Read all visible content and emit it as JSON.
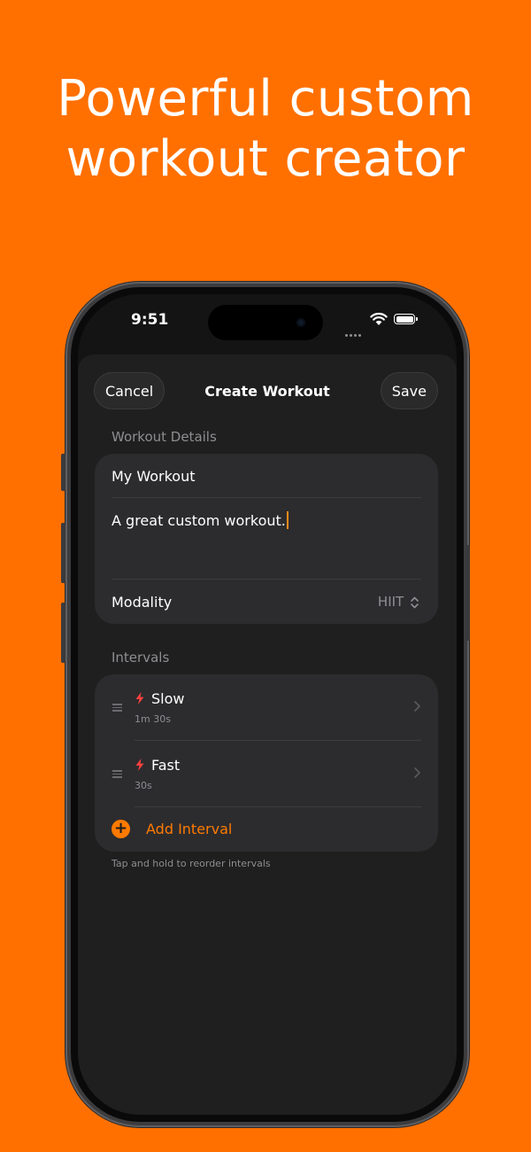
{
  "headline": {
    "line1": "Powerful custom",
    "line2": "workout creator"
  },
  "status_bar": {
    "time": "9:51"
  },
  "nav": {
    "cancel": "Cancel",
    "title": "Create Workout",
    "save": "Save"
  },
  "details": {
    "section_label": "Workout Details",
    "name_value": "My Workout",
    "description_value": "A great custom workout.",
    "modality_label": "Modality",
    "modality_value": "HIIT"
  },
  "intervals": {
    "section_label": "Intervals",
    "items": [
      {
        "name": "Slow",
        "duration": "1m 30s"
      },
      {
        "name": "Fast",
        "duration": "30s"
      }
    ],
    "add_label": "Add Interval",
    "footnote": "Tap and hold to reorder intervals"
  },
  "colors": {
    "background": "#ff7000",
    "accent": "#ff7a00",
    "bolt": "#ff4040",
    "surface": "#2c2c2e",
    "sheet": "#1f1f1f"
  },
  "icons": {
    "bolt": "lightning-bolt-icon",
    "grip": "drag-handle-icon",
    "chevron": "chevron-right-icon",
    "add": "plus-circle-icon",
    "picker": "chevron-up-down-icon"
  }
}
